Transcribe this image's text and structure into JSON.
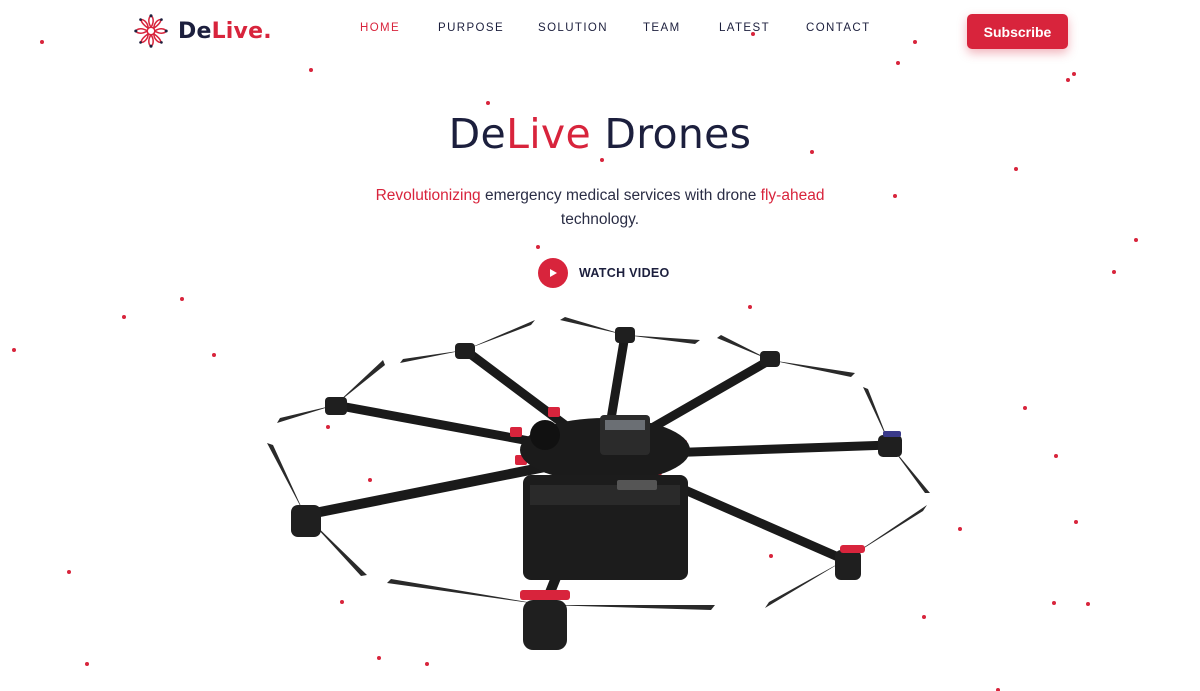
{
  "brand": {
    "name_main": "De",
    "name_accent": "Live",
    "name_dot": "."
  },
  "nav": {
    "items": [
      {
        "label": "HOME",
        "active": true
      },
      {
        "label": "PURPOSE",
        "active": false
      },
      {
        "label": "SOLUTION",
        "active": false
      },
      {
        "label": "TEAM",
        "active": false
      },
      {
        "label": "LATEST",
        "active": false
      },
      {
        "label": "CONTACT",
        "active": false
      }
    ],
    "subscribe_label": "Subscribe"
  },
  "hero": {
    "title_part1": "De",
    "title_accent": "Live",
    "title_part2": " Drones",
    "subtitle_hl1": "Revolutionizing",
    "subtitle_mid": " emergency medical services with drone ",
    "subtitle_hl2": "fly-ahead",
    "subtitle_end": " technology.",
    "watch_label": "WATCH VIDEO"
  },
  "colors": {
    "accent": "#d8243c",
    "navy": "#1c1f3d",
    "background": "#ffffff"
  },
  "icons": {
    "logo": "circuit-flower-icon",
    "play": "play-icon"
  }
}
